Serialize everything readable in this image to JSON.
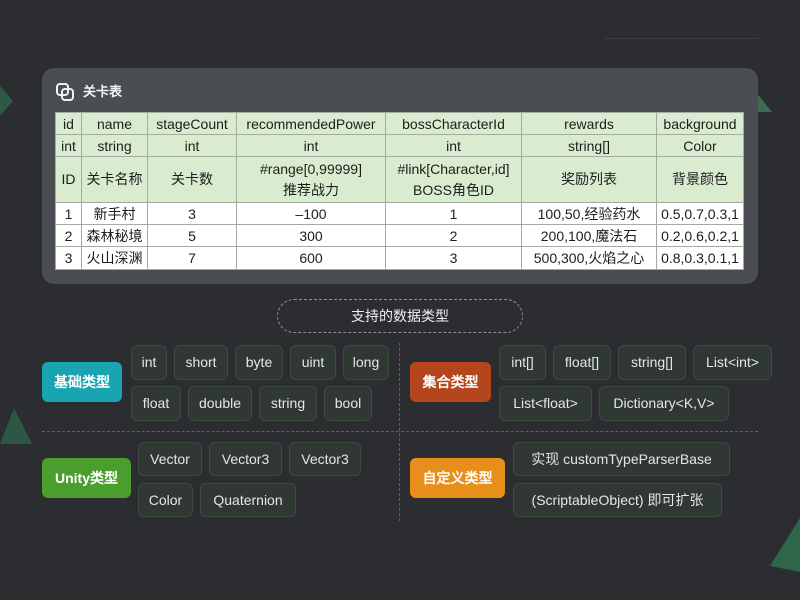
{
  "colors": {
    "page_background": "#2b2d31",
    "panel": "#4a4d52",
    "table_header_fill": "#d9ecd0",
    "table_body_fill": "#ffffff"
  },
  "panel": {
    "icon": "link-icon",
    "title": "关卡表"
  },
  "table": {
    "field_names": [
      "id",
      "name",
      "stageCount",
      "recommendedPower",
      "bossCharacterId",
      "rewards",
      "background"
    ],
    "field_types": [
      "int",
      "string",
      "int",
      "int",
      "int",
      "string[]",
      "Color"
    ],
    "field_descriptions": [
      [
        "ID"
      ],
      [
        "关卡名称"
      ],
      [
        "关卡数"
      ],
      [
        "#range[0,99999]",
        "推荐战力"
      ],
      [
        "#link[Character,id]",
        "BOSS角色ID"
      ],
      [
        "奖励列表"
      ],
      [
        "背景颜色"
      ]
    ],
    "rows": [
      [
        "1",
        "新手村",
        "3",
        "–100",
        "1",
        "100,50,经验药水",
        "0.5,0.7,0.3,1"
      ],
      [
        "2",
        "森林秘境",
        "5",
        "300",
        "2",
        "200,100,魔法石",
        "0.2,0.6,0.2,1"
      ],
      [
        "3",
        "火山深渊",
        "7",
        "600",
        "3",
        "500,300,火焰之心",
        "0.8,0.3,0.1,1"
      ]
    ]
  },
  "types_section": {
    "title": "支持的数据类型",
    "groups": [
      {
        "label": "基础类型",
        "color": "#19a4b1",
        "items": [
          "int",
          "short",
          "byte",
          "uint",
          "long",
          "float",
          "double",
          "string",
          "bool"
        ]
      },
      {
        "label": "集合类型",
        "color": "#b5451c",
        "items": [
          "int[]",
          "float[]",
          "string[]",
          "List<int>",
          "List<float>",
          "Dictionary<K,V>"
        ]
      },
      {
        "label": "Unity类型",
        "color": "#4a9e2d",
        "items": [
          "Vector",
          "Vector3",
          "Vector3",
          "Color",
          "Quaternion"
        ]
      },
      {
        "label": "自定义类型",
        "color": "#e88e1b",
        "items": [
          "实现 customTypeParserBase",
          "(ScriptableObject) 即可扩张"
        ]
      }
    ]
  }
}
